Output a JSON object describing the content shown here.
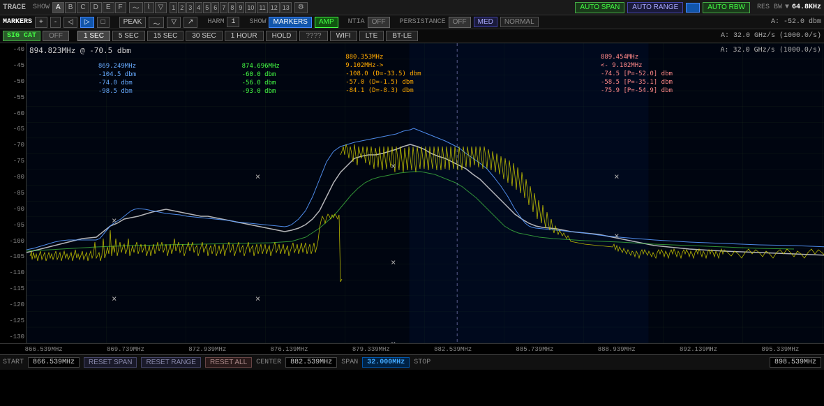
{
  "topbar": {
    "trace_label": "TRACE",
    "show_label": "SHOW",
    "trace_buttons": [
      "A",
      "B",
      "C",
      "D",
      "E",
      "F"
    ],
    "auto_span": "AUTO SPAN",
    "auto_range": "AUTO RANGE",
    "auto_rbw": "AUTO RBW",
    "res_bw_label": "RES BW",
    "res_bw_value": "64.8KHz",
    "a_level": "A: -52.0 dbm"
  },
  "markersbar": {
    "markers_label": "MARKERS",
    "peak_label": "PEAK",
    "harm_label": "HARM",
    "harm_val": "1",
    "show_label": "SHOW",
    "markers_btn": "MARKERS",
    "amp_btn": "AMP",
    "ntia_label": "NTIA",
    "off_btn": "OFF",
    "persistance_label": "PERSISTANCE",
    "off2_btn": "OFF",
    "med_btn": "MED",
    "normal_btn": "NORMAL",
    "a_level": "A: -52.0 dbm"
  },
  "sigbar": {
    "sig_cat": "SIG CAT",
    "off_btn": "OFF",
    "times": [
      "1 SEC",
      "5 SEC",
      "15 SEC",
      "30 SEC",
      "1 HOUR",
      "HOLD",
      "????",
      "WIFI",
      "LTE",
      "BT-LE"
    ],
    "a_rate": "A: 32.0 GHz/s (1000.0/s)"
  },
  "chart": {
    "title": "894.823MHz @ -70.5 dbm",
    "y_labels": [
      "-40",
      "-45",
      "-50",
      "-55",
      "-60",
      "-65",
      "-70",
      "-75",
      "-80",
      "-85",
      "-90",
      "-95",
      "-100",
      "-105",
      "-110",
      "-115",
      "-120",
      "-125",
      "-130"
    ],
    "freq_labels": [
      "866.539MHz",
      "869.739MHz",
      "872.939MHz",
      "876.139MHz",
      "879.339MHz",
      "882.539MHz",
      "885.739MHz",
      "888.939MHz",
      "892.139MHz",
      "895.339MHz"
    ],
    "markers": [
      {
        "freq": "869.249MHz",
        "dbm1": "-104.5 dbm",
        "dbm2": "-74.0 dbm",
        "dbm3": "-98.5 dbm",
        "color": "#4af"
      },
      {
        "freq": "874.696MHz",
        "dbm1": "-60.0 dbm",
        "dbm2": "-56.0 dbm",
        "dbm3": "-93.0 dbm",
        "color": "#4f4"
      },
      {
        "freq": "880.353MHz",
        "dbm1": "-108.0 (D=-33.5) dbm",
        "dbm2": "-57.0 (D=-1.5) dbm",
        "dbm3": "-84.1 (D=-8.3) dbm",
        "arrow": "9.102MHz->",
        "color": "#fa0"
      },
      {
        "freq": "889.454MHz",
        "dbm1": "-74.5 [P=-52.0] dbm",
        "dbm2": "-58.5 [P=-35.1] dbm",
        "dbm3": "-75.9 [P=-54.9] dbm",
        "arrow": "<- 9.102MHz",
        "color": "#f88"
      }
    ],
    "vert_line_pos": "54%"
  },
  "bottombar": {
    "start_label": "START",
    "start_val": "866.539MHz",
    "reset_span": "RESET SPAN",
    "reset_range": "RESET RANGE",
    "reset_all": "RESET ALL",
    "center_label": "CENTER",
    "center_val": "882.539MHz",
    "span_label": "SPAN",
    "span_val": "32.000MHz",
    "stop_label": "STOP",
    "stop_val": "898.539MHz"
  }
}
